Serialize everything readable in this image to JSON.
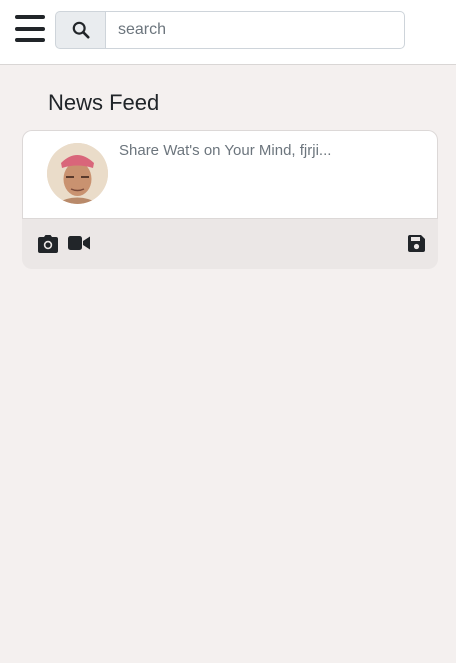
{
  "header": {
    "menu_icon": "hamburger-menu-icon",
    "search_icon": "search-icon",
    "search_placeholder": "search"
  },
  "feed": {
    "title": "News Feed"
  },
  "composer": {
    "placeholder_text": "Share Wat's on Your Mind, fjrji...",
    "actions": {
      "photo_icon": "camera-icon",
      "video_icon": "video-camera-icon",
      "save_icon": "floppy-disk-save-icon"
    }
  },
  "colors": {
    "page_bg": "#f4f0ef",
    "card_footer_bg": "#ebe7e6",
    "icon": "#212529"
  }
}
